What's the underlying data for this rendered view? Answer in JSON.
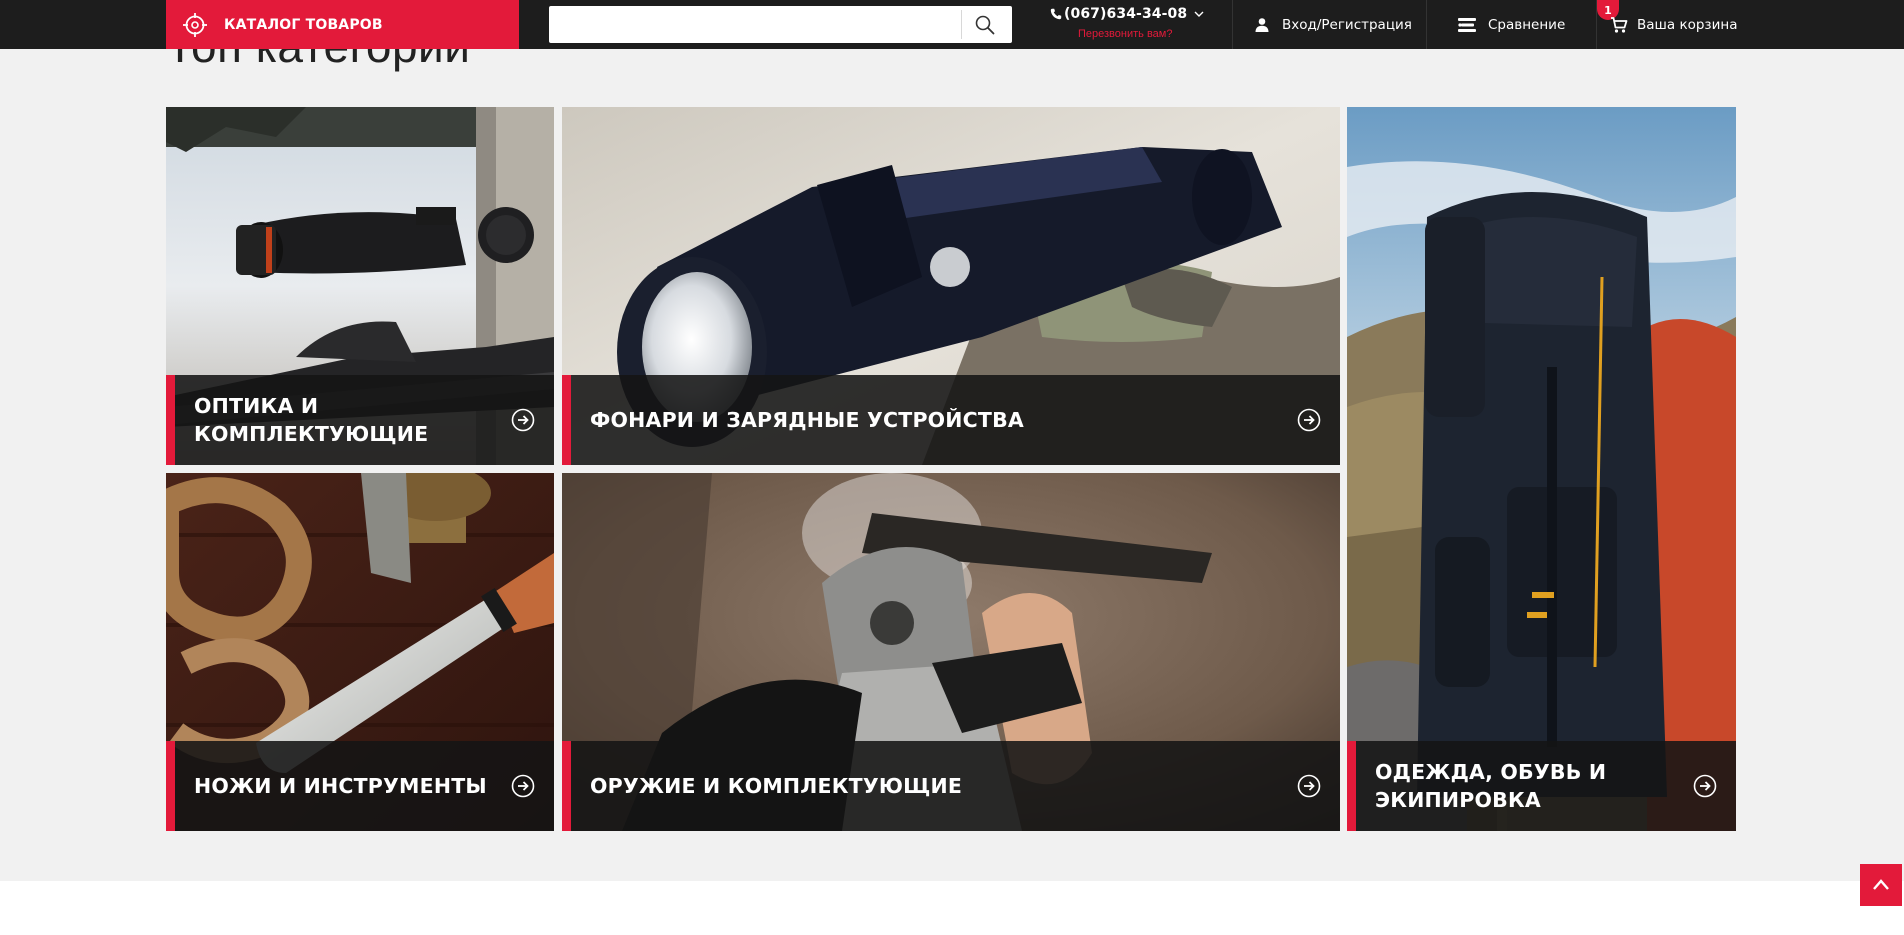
{
  "header": {
    "catalog_label": "КАТАЛОГ ТОВАРОВ",
    "search_value": "",
    "phone": "(067)634-34-08",
    "callback_label": "Перезвонить вам?",
    "login_label": "Вход/Регистрация",
    "compare_label": "Сравнение",
    "cart_label": "Ваша корзина",
    "cart_count": "1"
  },
  "section": {
    "title": "Топ категории"
  },
  "categories": [
    {
      "title": "ОПТИКА И КОМПЛЕКТУЮЩИЕ",
      "image": "rifle-scope-photo"
    },
    {
      "title": "ФОНАРИ И ЗАРЯДНЫЕ УСТРОЙСТВА",
      "image": "flashlight-photo"
    },
    {
      "title": "ОДЕЖДА, ОБУВЬ И ЭКИПИРОВКА",
      "image": "backpack-photo"
    },
    {
      "title": "НОЖИ И ИНСТРУМЕНТЫ",
      "image": "knife-rope-photo"
    },
    {
      "title": "ОРУЖИЕ И КОМПЛЕКТУЮЩИЕ",
      "image": "shotgun-photo"
    }
  ],
  "colors": {
    "accent": "#e31a3a",
    "header_bg": "#1d1d1d",
    "section_bg": "#f1f1f1"
  },
  "icons": {
    "catalog": "crosshair-icon",
    "search": "search-icon",
    "phone": "phone-icon",
    "login": "user-icon",
    "compare": "compare-icon",
    "cart": "cart-icon",
    "tile_arrow": "arrow-right-circle-icon",
    "scroll_top": "chevron-up-icon"
  }
}
